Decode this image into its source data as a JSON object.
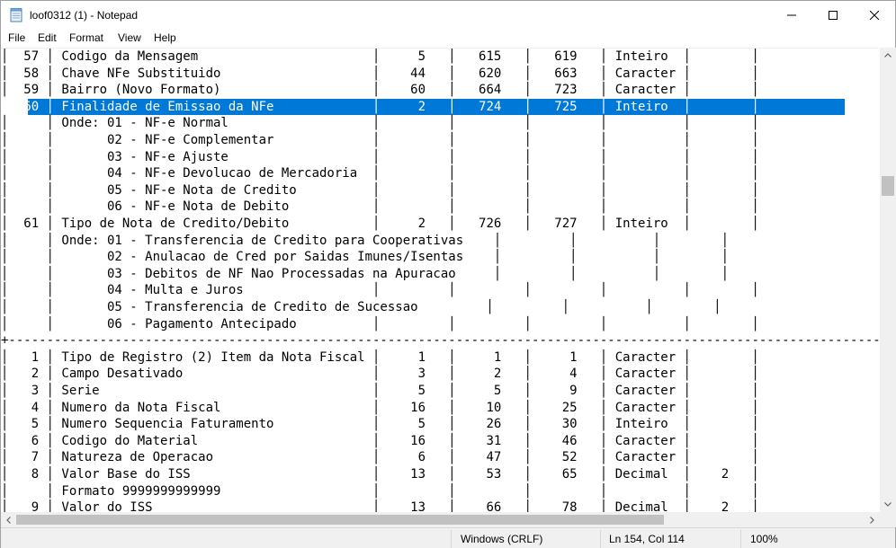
{
  "window": {
    "title": "loof0312 (1) - Notepad"
  },
  "menu": [
    "File",
    "Edit",
    "Format",
    "View",
    "Help"
  ],
  "selected_line_index": 3,
  "lines": [
    "│  57 │ Codigo da Mensagem                       │     5   │   615   │   619   │ Inteiro  │        │",
    "│  58 │ Chave NFe Substituido                    │    44   │   620   │   663   │ Caracter │        │",
    "│  59 │ Bairro (Novo Formato)                    │    60   │   664   │   723   │ Caracter │        │",
    "│  60 │ Finalidade de Emissao da NFe             │     2   │   724   │   725   │ Inteiro  │        │",
    "│     │ Onde: 01 - NF-e Normal                   │         │         │         │          │        │",
    "│     │       02 - NF-e Complementar             │         │         │         │          │        │",
    "│     │       03 - NF-e Ajuste                   │         │         │         │          │        │",
    "│     │       04 - NF-e Devolucao de Mercadoria  │         │         │         │          │        │",
    "│     │       05 - NF-e Nota de Credito          │         │         │         │          │        │",
    "│     │       06 - NF-e Nota de Debito           │         │         │         │          │        │",
    "│  61 │ Tipo de Nota de Credito/Debito           │     2   │   726   │   727   │ Inteiro  │        │",
    "│     │ Onde: 01 - Transferencia de Credito para Cooperativas    │         │          │        │",
    "│     │       02 - Anulacao de Cred por Saidas Imunes/Isentas    │         │          │        │",
    "│     │       03 - Debitos de NF Nao Processadas na Apuracao     │         │          │        │",
    "│     │       04 - Multa e Juros                 │         │         │         │          │        │",
    "│     │       05 - Transferencia de Credito de Sucessao         │         │          │        │",
    "│     │       06 - Pagamento Antecipado          │         │         │         │          │        │",
    "+-------------------------------------------------------------------------------------------------------------------",
    "│   1 │ Tipo de Registro (2) Item da Nota Fiscal │     1   │     1   │     1   │ Caracter │        │",
    "│   2 │ Campo Desativado                         │     3   │     2   │     4   │ Caracter │        │",
    "│   3 │ Serie                                    │     5   │     5   │     9   │ Caracter │        │",
    "│   4 │ Numero da Nota Fiscal                    │    16   │    10   │    25   │ Caracter │        │",
    "│   5 │ Numero Sequencia Faturamento             │     5   │    26   │    30   │ Inteiro  │        │",
    "│   6 │ Codigo do Material                       │    16   │    31   │    46   │ Caracter │        │",
    "│   7 │ Natureza de Operacao                     │     6   │    47   │    52   │ Caracter │        │",
    "│   8 │ Valor Base do ISS                        │    13   │    53   │    65   │ Decimal  │    2   │",
    "│     │ Formato 9999999999999                    │         │         │         │          │        │",
    "│   9 │ Valor do ISS                             │    13   │    66   │    78   │ Decimal  │    2   │"
  ],
  "status": {
    "line_endings": "Windows (CRLF)",
    "position": "Ln 154, Col 114",
    "zoom": "100%"
  }
}
